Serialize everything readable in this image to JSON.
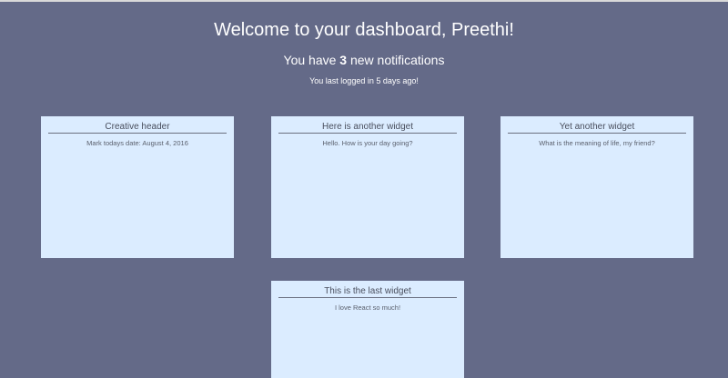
{
  "header": {
    "welcome": "Welcome to your dashboard, Preethi!",
    "notifications_prefix": "You have ",
    "notifications_count": "3",
    "notifications_suffix": " new notifications",
    "last_login": "You last logged in 5 days ago!"
  },
  "widgets": [
    {
      "title": "Creative header",
      "body": "Mark todays date: August 4, 2016"
    },
    {
      "title": "Here is another widget",
      "body": "Hello. How is your day going?"
    },
    {
      "title": "Yet another widget",
      "body": "What is the meaning of life, my friend?"
    },
    {
      "title": "This is the last widget",
      "body": "I love React so much!"
    }
  ],
  "colors": {
    "background": "#646a88",
    "widget_background": "#dbecff",
    "header_text": "#ffffff"
  }
}
